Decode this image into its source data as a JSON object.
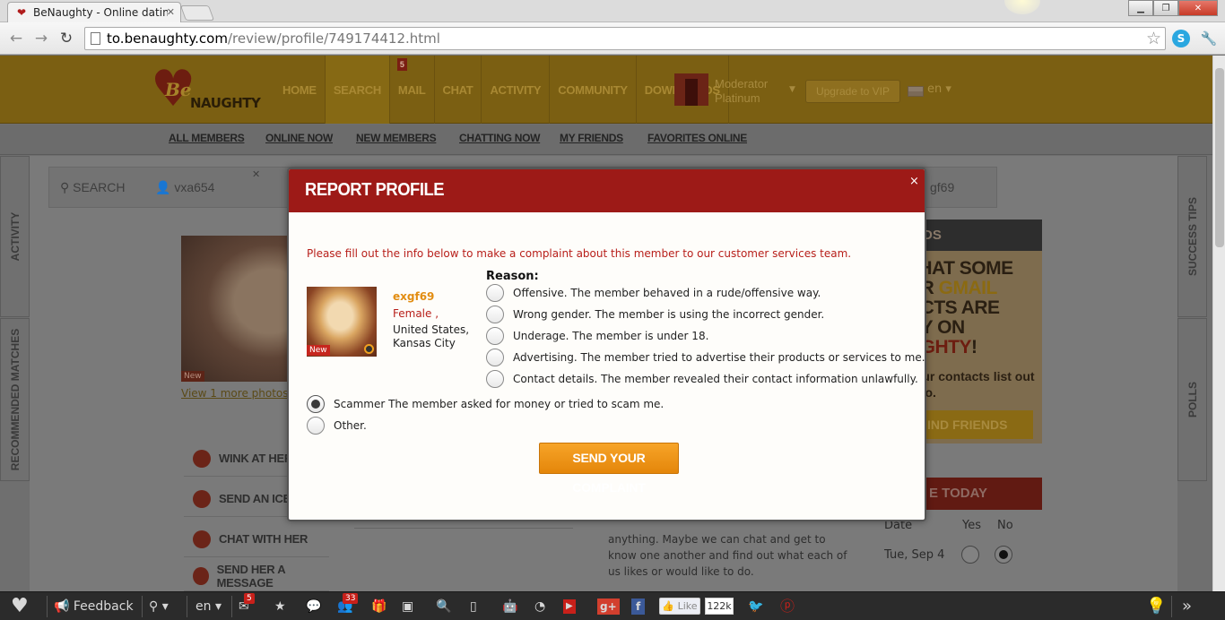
{
  "browser": {
    "tab_title": "BeNaughty - Online dating",
    "url_host": "to.benaughty.com",
    "url_path": "/review/profile/749174412.html"
  },
  "site": {
    "logo_be": "Be",
    "logo_naughty": "NAUGHTY",
    "nav": [
      "HOME",
      "SEARCH",
      "MAIL",
      "CHAT",
      "ACTIVITY",
      "COMMUNITY",
      "DOWNLOADS"
    ],
    "mail_badge": "5",
    "moderator": "Moderator",
    "moderator_level": "Platinum",
    "vip_button": "Upgrade to VIP",
    "lang": "en",
    "subnav": [
      "ALL MEMBERS",
      "ONLINE NOW",
      "NEW MEMBERS",
      "CHATTING NOW",
      "MY FRIENDS",
      "FAVORITES ONLINE"
    ]
  },
  "page": {
    "side_activity": "ACTIVITY",
    "side_recommended": "RECOMMENDED MATCHES",
    "side_success": "SUCCESS TIPS",
    "side_polls": "POLLS",
    "search_label": "SEARCH",
    "search_user1": "vxa654",
    "search_user2": "gf69",
    "photo_new": "New",
    "view_more": "View 1 more photos",
    "actions": [
      "WINK AT HER",
      "SEND AN ICE B",
      "CHAT WITH HER",
      "SEND HER A MESSAGE"
    ],
    "mid_text": "anything. Maybe we can chat and get to know one another and find out what each of us likes or would like to do.",
    "friends_head": "IENDS",
    "friends_big_1": " THAT SOME",
    "friends_big_2a": "UR ",
    "friends_big_2b": "GMAIL",
    "friends_big_3": "ACTS ARE",
    "friends_big_4": "DY ON",
    "friends_big_5a": "UGHTY",
    "friends_big_5b": "!",
    "friends_small": "your contacts list out who.",
    "friends_btn": "IND FRIENDS",
    "today_head": "E TODAY",
    "today_date_h": "Date",
    "today_yes": "Yes",
    "today_no": "No",
    "today_date": "Tue, Sep 4"
  },
  "modal": {
    "title": "REPORT PROFILE",
    "close": "×",
    "intro": "Please fill out the info below to make a complaint about this member to our customer services team.",
    "user": {
      "name": "exgf69",
      "gender": "Female ,",
      "location": "United States, Kansas City",
      "badge": "New"
    },
    "reason_label": "Reason:",
    "options": [
      {
        "label": "Offensive. The member behaved in a rude/offensive way.",
        "selected": false
      },
      {
        "label": "Wrong gender. The member is using the incorrect gender.",
        "selected": false
      },
      {
        "label": "Underage. The member is under 18.",
        "selected": false
      },
      {
        "label": "Advertising. The member tried to advertise their products or services to me.",
        "selected": false
      },
      {
        "label": "Contact details. The member revealed their contact information unlawfully.",
        "selected": false
      },
      {
        "label": "Scammer The member asked for money or tried to scam me.",
        "selected": true
      },
      {
        "label": "Other.",
        "selected": false
      }
    ],
    "submit": "SEND YOUR COMPLAINT"
  },
  "bottombar": {
    "feedback": "Feedback",
    "lang": "en",
    "mail_count": "5",
    "friends_count": "33",
    "like": "Like",
    "like_count": "122k"
  },
  "colors": {
    "modal_header": "#9d1a17",
    "intro_text": "#b8201b",
    "username": "#e28d12",
    "submit": "#f39a1e"
  }
}
